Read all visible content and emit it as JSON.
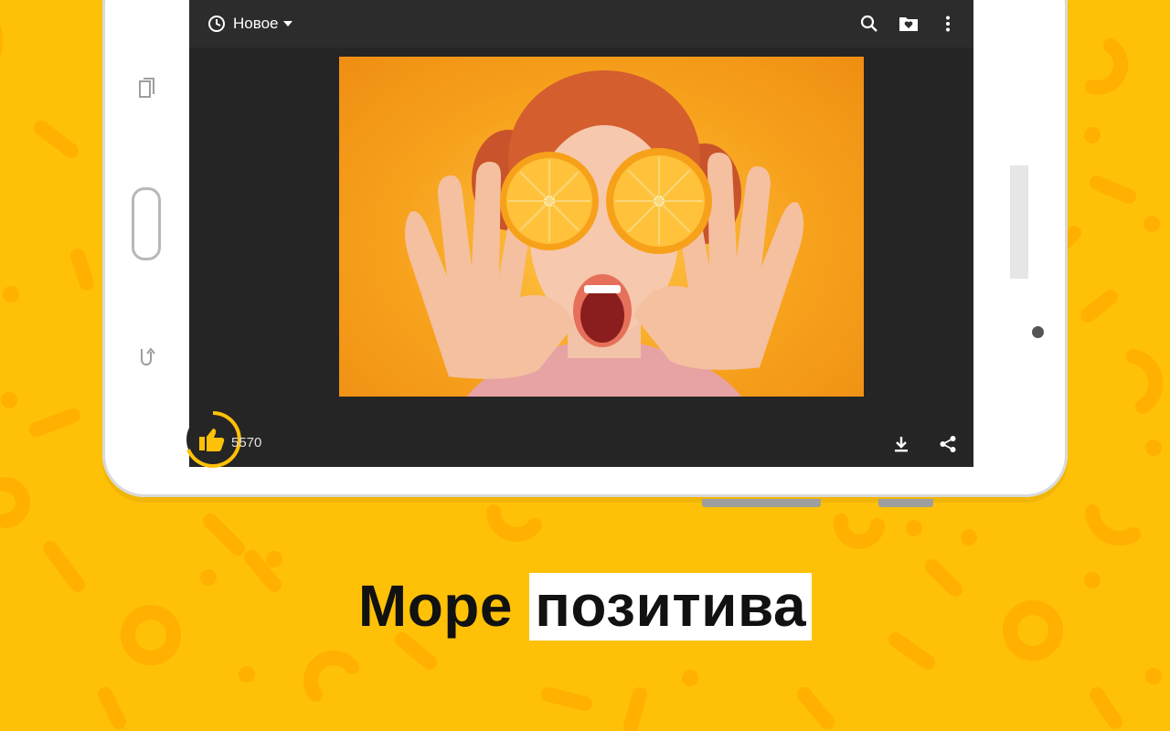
{
  "colors": {
    "background": "#ffc107",
    "accent": "#ffc107",
    "screen": "#252525",
    "appbar": "#2c2c2c"
  },
  "toolbar": {
    "sort_label": "Новое",
    "icons": [
      "clock-icon",
      "search-icon",
      "folder-heart-icon",
      "more-vert-icon"
    ]
  },
  "post": {
    "likes": "5570",
    "icons": [
      "thumbs-up-icon",
      "download-icon",
      "share-icon"
    ]
  },
  "caption": {
    "part1": "Море",
    "part2": "позитива"
  }
}
